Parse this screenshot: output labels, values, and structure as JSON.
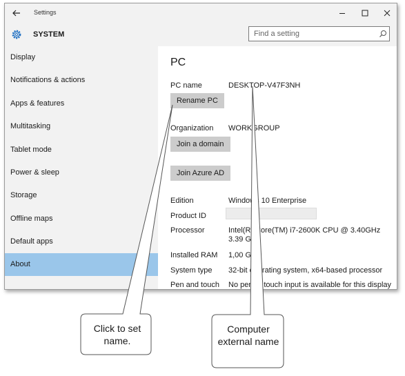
{
  "window": {
    "title": "Settings"
  },
  "header": {
    "section": "SYSTEM",
    "search_placeholder": "Find a setting"
  },
  "sidebar": {
    "items": [
      {
        "label": "Display"
      },
      {
        "label": "Notifications & actions"
      },
      {
        "label": "Apps & features"
      },
      {
        "label": "Multitasking"
      },
      {
        "label": "Tablet mode"
      },
      {
        "label": "Power & sleep"
      },
      {
        "label": "Storage"
      },
      {
        "label": "Offline maps"
      },
      {
        "label": "Default apps"
      },
      {
        "label": "About"
      }
    ],
    "selected": "About"
  },
  "content": {
    "title": "PC",
    "pc_name_label": "PC name",
    "pc_name_value": "DESKTOP-V47F3NH",
    "rename_button": "Rename PC",
    "organization_label": "Organization",
    "organization_value": "WORKGROUP",
    "join_domain_button": "Join a domain",
    "join_azure_button": "Join Azure AD",
    "edition_label": "Edition",
    "edition_value": "Windows 10 Enterprise",
    "product_id_label": "Product ID",
    "processor_label": "Processor",
    "processor_value": "Intel(R) Core(TM) i7-2600K CPU @ 3.40GHz   3.39 GHz",
    "ram_label": "Installed RAM",
    "ram_value": "1,00 GB",
    "system_type_label": "System type",
    "system_type_value": "32-bit operating system, x64-based processor",
    "pen_touch_label": "Pen and touch",
    "pen_touch_value": "No pen or touch input is available for this display"
  },
  "callouts": {
    "left_text": "Click to set name.",
    "right_text": "Computer external name"
  },
  "colors": {
    "chrome_bg": "#f2f2f2",
    "selected_nav": "#9ac6ea",
    "button_bg": "#cccccc",
    "gear_accent": "#1e6fc2"
  }
}
